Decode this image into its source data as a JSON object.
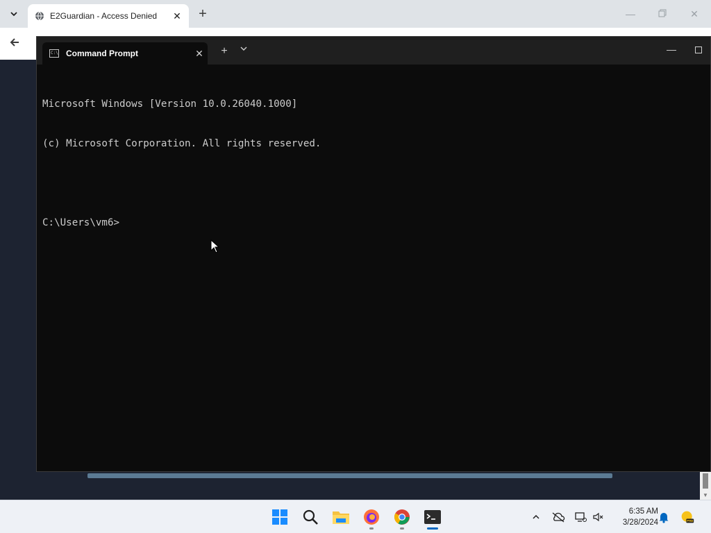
{
  "browser": {
    "tab_title": "E2Guardian - Access Denied",
    "new_tab_symbol": "+",
    "close_symbol": "✕"
  },
  "terminal": {
    "tab_title": "Command Prompt",
    "lines": [
      "Microsoft Windows [Version 10.0.26040.1000]",
      "(c) Microsoft Corporation. All rights reserved.",
      "",
      "C:\\Users\\vm6>"
    ]
  },
  "taskbar": {
    "apps": [
      "windows-start",
      "search",
      "file-explorer",
      "firefox",
      "chrome",
      "terminal"
    ],
    "time": "6:35 AM",
    "date": "3/28/2024"
  },
  "icons": {
    "tab_search": "chevron-down-icon",
    "globe": "globe-icon",
    "back": "back-arrow-icon"
  },
  "colors": {
    "terminal_bg": "#0c0c0c",
    "terminal_text": "#cccccc",
    "accent": "#0067c0"
  }
}
